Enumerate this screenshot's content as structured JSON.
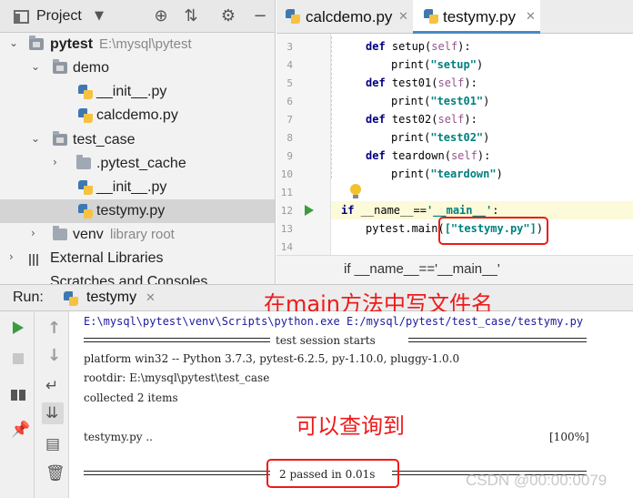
{
  "project_panel": {
    "title": "Project",
    "tree": [
      {
        "label": "pytest",
        "path": "E:\\mysql\\pytest"
      },
      {
        "label": "demo"
      },
      {
        "label": "__init__.py"
      },
      {
        "label": "calcdemo.py"
      },
      {
        "label": "test_case"
      },
      {
        "label": ".pytest_cache"
      },
      {
        "label": "__init__.py"
      },
      {
        "label": "testymy.py"
      },
      {
        "label": "venv",
        "path": "library root"
      },
      {
        "label": "External Libraries"
      },
      {
        "label": "Scratches and Consoles"
      }
    ]
  },
  "editor": {
    "tabs": [
      {
        "label": "calcdemo.py"
      },
      {
        "label": "testymy.py"
      }
    ],
    "line_numbers": [
      "3",
      "4",
      "5",
      "6",
      "7",
      "8",
      "9",
      "10",
      "11",
      "12",
      "13",
      "14"
    ],
    "code": {
      "l3_kw": "def",
      "l3_fn": " setup(",
      "l3_self": "self",
      "l3_end": "):",
      "l4_fn": "print(",
      "l4_str": "\"setup\"",
      "l4_end": ")",
      "l5_kw": "def",
      "l5_fn": " test01(",
      "l5_self": "self",
      "l5_end": "):",
      "l6_fn": "print(",
      "l6_str": "\"test01\"",
      "l6_end": ")",
      "l7_kw": "def",
      "l7_fn": " test02(",
      "l7_self": "self",
      "l7_end": "):",
      "l8_fn": "print(",
      "l8_str": "\"test02\"",
      "l8_end": ")",
      "l9_kw": "def",
      "l9_fn": " teardown(",
      "l9_self": "self",
      "l9_end": "):",
      "l10_fn": "print(",
      "l10_str": "\"teardown\"",
      "l10_end": ")",
      "l12_kw": "if",
      "l12_mid": " __name__==",
      "l12_str": "'__main__'",
      "l12_end": ":",
      "l13_fn": "pytest.main(",
      "l13_str": "[\"testymy.py\"]",
      "l13_end": ")"
    },
    "breadcrumb": "if __name__=='__main__'"
  },
  "run_panel": {
    "title": "Run:",
    "tab_label": "testymy",
    "annotation_top": "在main方法中写文件名",
    "annotation_mid": "可以查询到",
    "console": {
      "command": "E:\\mysql\\pytest\\venv\\Scripts\\python.exe E:/mysql/pytest/test_case/testymy.py",
      "session_title": "test session starts",
      "platform": "platform win32 -- Python 3.7.3, pytest-6.2.5, py-1.10.0, pluggy-1.0.0",
      "rootdir": "rootdir: E:\\mysql\\pytest\\test_case",
      "collected": "collected 2 items",
      "result_file": "testymy.py ..",
      "result_pct": "[100%]",
      "summary": "2 passed in 0.01s"
    }
  },
  "watermark": "CSDN @00:00:0079",
  "colors": {
    "annotation_red": "#ee1b1b",
    "keyword": "#000080",
    "string": "#008080",
    "self": "#94558d",
    "run_green": "#3d9b40",
    "tab_underline": "#4a88c7"
  }
}
